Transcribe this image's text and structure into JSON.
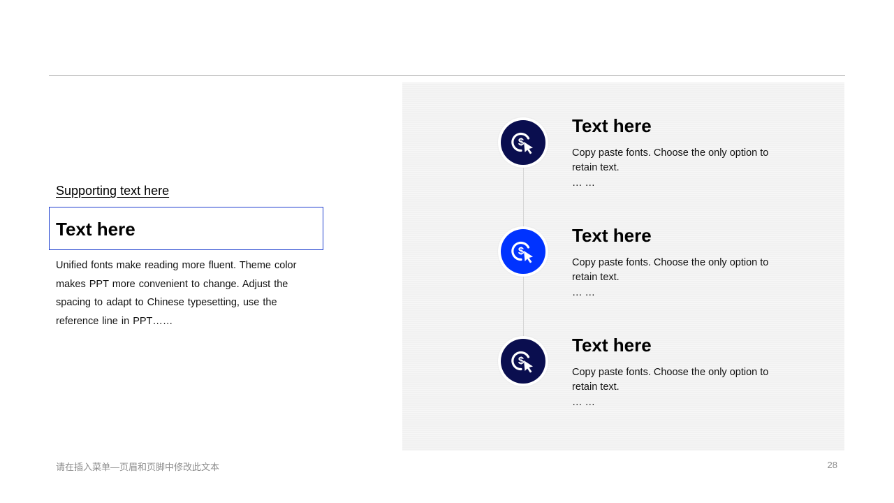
{
  "left": {
    "supporting_text": "Supporting text here",
    "title": "Text here",
    "body": "Unified fonts make reading more fluent. Theme color makes PPT more convenient to change. Adjust the spacing to adapt to Chinese typesetting, use the reference line in PPT……"
  },
  "timeline": {
    "items": [
      {
        "icon": "dollar-click-icon",
        "circle_color": "#0a0e4f",
        "title": "Text here",
        "description": "Copy paste fonts. Choose the only option to retain text.",
        "ellipsis": "… …"
      },
      {
        "icon": "dollar-click-icon",
        "circle_color": "#0033ff",
        "title": "Text here",
        "description": "Copy paste fonts. Choose the only option to retain text.",
        "ellipsis": "… …"
      },
      {
        "icon": "dollar-click-icon",
        "circle_color": "#0a0e4f",
        "title": "Text here",
        "description": "Copy paste fonts. Choose the only option to retain text.",
        "ellipsis": "… …"
      }
    ]
  },
  "footer": {
    "text": "请在插入菜单—页眉和页脚中修改此文本",
    "page_number": "28"
  },
  "colors": {
    "accent_blue": "#0033ff",
    "dark_navy": "#0a0e4f",
    "title_box_border": "#1f3fcf",
    "panel_background": "#f1f1f1"
  }
}
